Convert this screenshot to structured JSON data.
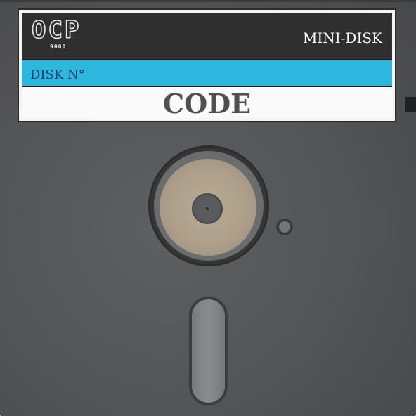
{
  "label": {
    "brand": "OCP",
    "brand_sub": "9000",
    "type": "MINI-DISK",
    "disk_no_label": "DISK N°",
    "title": "CODE"
  },
  "colors": {
    "shell": "#535456",
    "label_band_dark": "#2f2f30",
    "label_band_blue": "#2db7de",
    "hub_disk": "#ad9f89"
  }
}
